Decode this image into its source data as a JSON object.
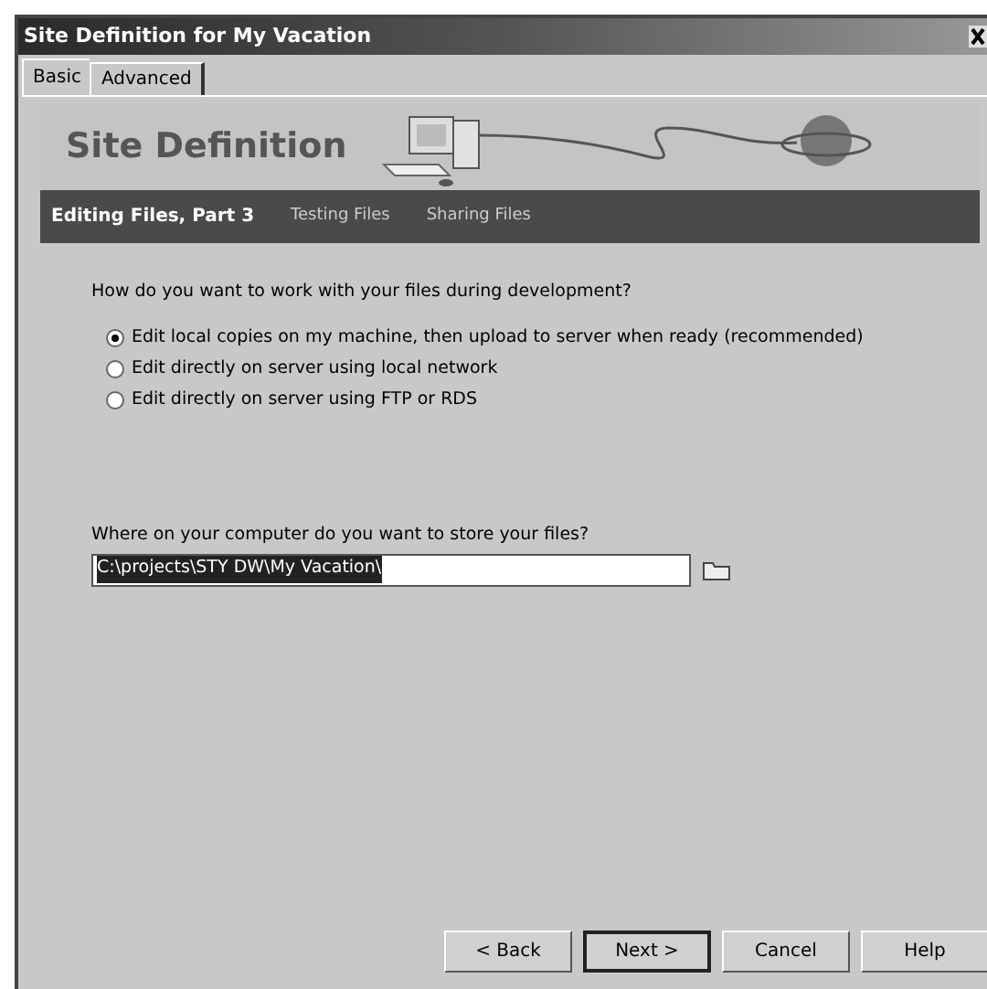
{
  "window": {
    "title": "Site Definition for My Vacation"
  },
  "tabs": [
    {
      "label": "Basic",
      "selected": true
    },
    {
      "label": "Advanced",
      "selected": false
    }
  ],
  "banner": {
    "title": "Site Definition"
  },
  "steps": [
    {
      "label": "Editing Files, Part 3",
      "selected": true
    },
    {
      "label": "Testing Files",
      "selected": false
    },
    {
      "label": "Sharing Files",
      "selected": false
    }
  ],
  "question": "How do you want to work with your files during development?",
  "options": [
    {
      "label": "Edit local copies on my machine, then upload to server when ready (recommended)",
      "selected": true
    },
    {
      "label": "Edit directly on server using local network",
      "selected": false
    },
    {
      "label": "Edit directly on server using FTP or RDS",
      "selected": false
    }
  ],
  "folder": {
    "label": "Where on your computer do you want to store your files?",
    "value": "C:\\projects\\STY DW\\My Vacation\\"
  },
  "buttons": [
    {
      "label": "< Back",
      "default": false
    },
    {
      "label": "Next >",
      "default": true
    },
    {
      "label": "Cancel",
      "default": false
    },
    {
      "label": "Help",
      "default": false
    }
  ]
}
